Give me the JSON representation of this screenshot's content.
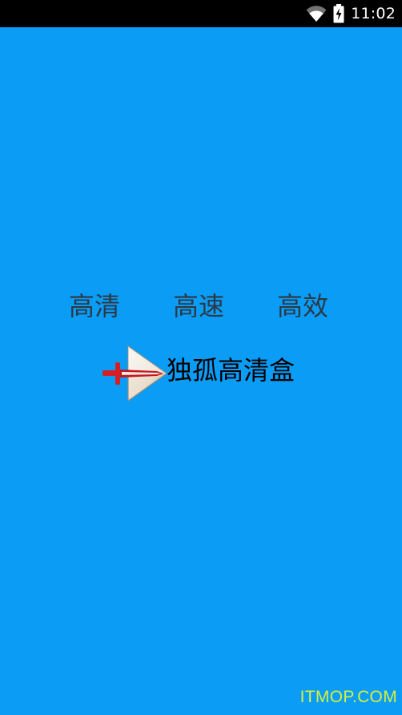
{
  "status_bar": {
    "time": "11:02",
    "icons": [
      "wifi-icon",
      "battery-charging-icon"
    ]
  },
  "splash": {
    "features": [
      "高清",
      "高速",
      "高效"
    ],
    "app_name": "独孤高清盒",
    "logo_icon": "sword-play-logo-icon",
    "background_color": "#0b9cf6"
  },
  "watermark": {
    "text": "ITMOP.COM"
  }
}
